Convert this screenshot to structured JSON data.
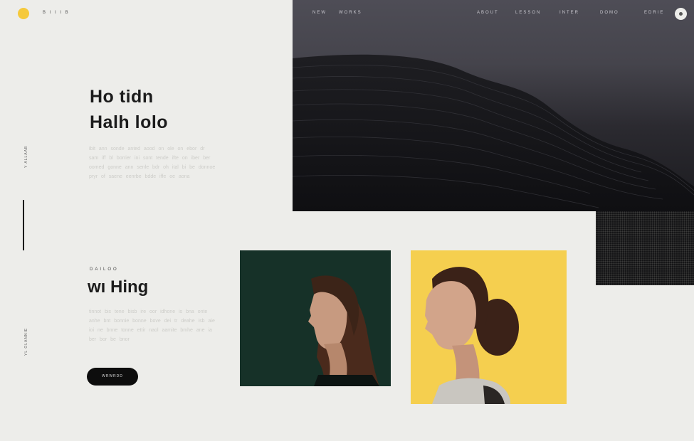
{
  "brand": {
    "name": "B I I I B"
  },
  "nav": {
    "left_items": [
      "NEW",
      "WORKS"
    ],
    "right_items": [
      "ABOUT",
      "LESSON",
      "INTER",
      "DOMO",
      "EDRIE"
    ]
  },
  "side": {
    "top_label": "Y ALLAAB",
    "bottom_label": "YL OLANNIE"
  },
  "hero": {
    "title_line1": "Ho tidn",
    "title_line2": "Halh lolo",
    "paragraph": "ibit ann sonde anted aood on ole on ebor dr sam  iff bl borrier ini sont tende ifte on iber  ber oomed  gonne ann senle bdr oh ital bi be donnoe pryr of saene eenrbe bdde iffe oe aona"
  },
  "section": {
    "eyebrow": "DAILOO",
    "title": "wı Hing",
    "paragraph": "tinnot bis tene bisb ire oor idhone is bna onte anhe bnt bonnie bonne bove dei tr deahe isb aie ioi ne bnne tonne ettir naol aamite bmhe ane ia ber bor be bnor",
    "cta_label": "WRWRDD"
  },
  "colors": {
    "accent_yellow": "#f5c93b",
    "dark": "#1b1b1f",
    "background": "#ededea",
    "teal": "#163128"
  }
}
